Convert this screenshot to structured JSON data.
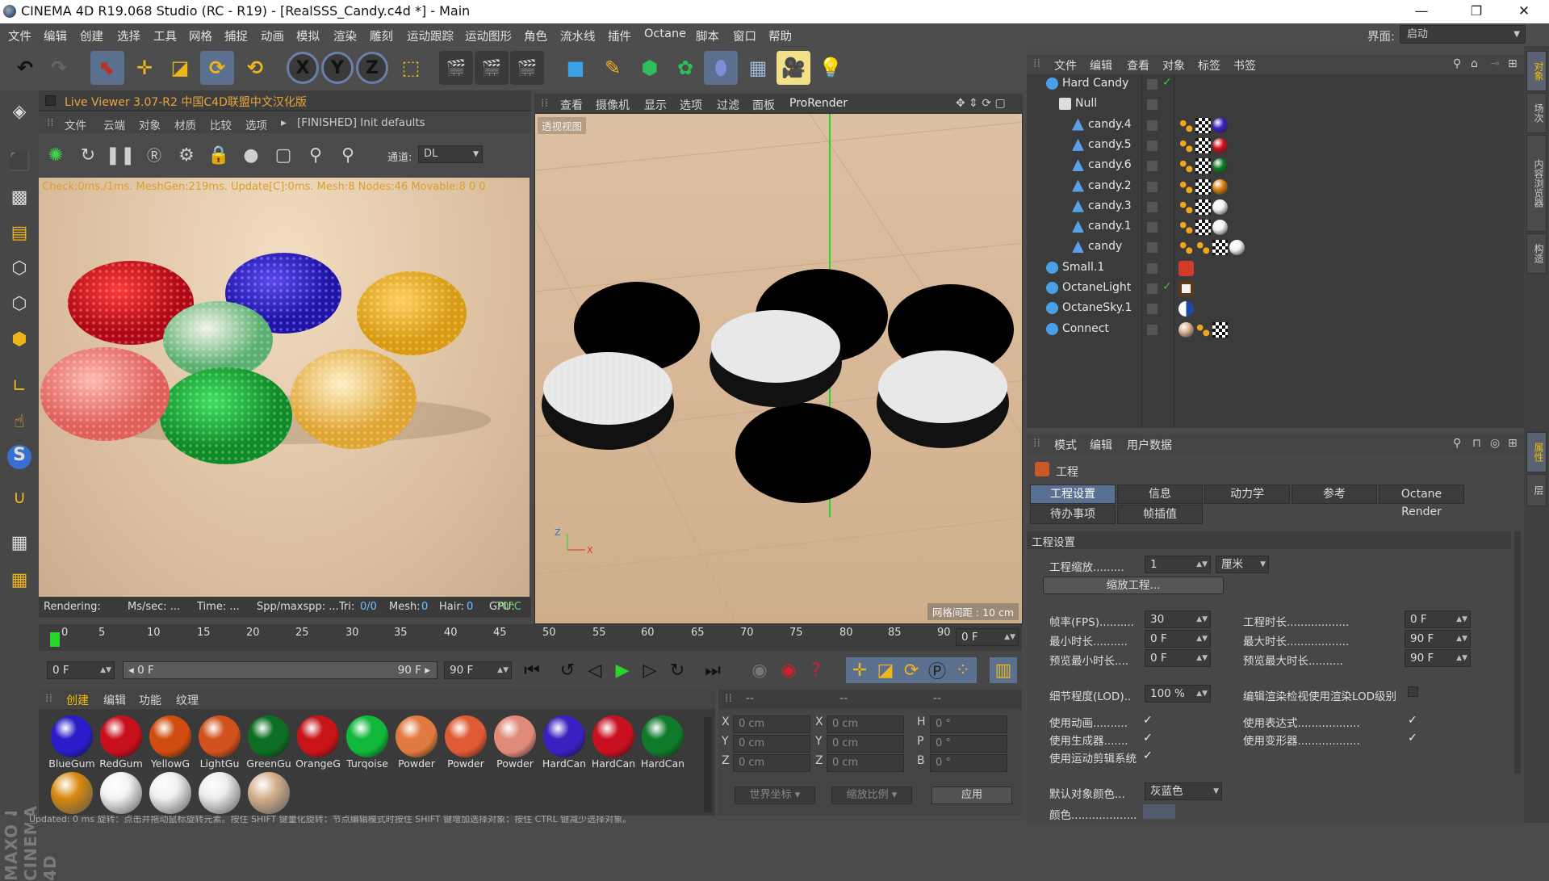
{
  "window": {
    "title": "CINEMA 4D R19.068 Studio (RC - R19) - [RealSSS_Candy.c4d *] - Main",
    "minimize": "—",
    "maximize": "❐",
    "close": "✕"
  },
  "menubar": {
    "items": [
      "文件",
      "编辑",
      "创建",
      "选择",
      "工具",
      "网格",
      "捕捉",
      "动画",
      "模拟",
      "渲染",
      "雕刻",
      "运动跟踪",
      "运动图形",
      "角色",
      "流水线",
      "插件",
      "Octane",
      "脚本",
      "窗口",
      "帮助"
    ],
    "layout_label": "界面:",
    "layout_value": "启动"
  },
  "toolbar": {
    "axis_x": "X",
    "axis_y": "Y",
    "axis_z": "Z"
  },
  "right_tabs": [
    "对象",
    "场次",
    "内容浏览器",
    "构造",
    "属性",
    "层"
  ],
  "live_viewer": {
    "title": "Live Viewer 3.07-R2 中国C4D联盟中文汉化版",
    "menu": [
      "文件",
      "云端",
      "对象",
      "材质",
      "比较",
      "选项",
      "▸",
      "[FINISHED] Init defaults"
    ],
    "channel_label": "通道:",
    "channel_value": "DL",
    "render_stats": "Check:0ms./1ms. MeshGen:219ms. Update[C]:0ms. Mesh:8 Nodes:46 Movable:8  0 0",
    "status": {
      "rendering": "Rendering:",
      "ms_sec": "Ms/sec: ...",
      "time": "Time: ...",
      "spp": "Spp/maxspp: ...",
      "tri_label": "Tri:",
      "tri_value": "0/0",
      "mesh_label": "Mesh:",
      "mesh_value": "0",
      "hair_label": "Hair:",
      "hair_value": "0",
      "gpu_label": "GPU:",
      "gpu_value": "70°C"
    }
  },
  "viewport": {
    "menu": [
      "查看",
      "摄像机",
      "显示",
      "选项",
      "过滤",
      "面板",
      "ProRender"
    ],
    "label": "透视视图",
    "grid_label": "网格间距 : 10 cm"
  },
  "timeline": {
    "ticks": [
      "0",
      "5",
      "10",
      "15",
      "20",
      "25",
      "30",
      "35",
      "40",
      "45",
      "50",
      "55",
      "60",
      "65",
      "70",
      "75",
      "80",
      "85",
      "90"
    ],
    "current_frame": "0 F",
    "start_field": "0 F",
    "range_start": "◂ 0 F",
    "range_end": "90 F ▸",
    "end_field": "90 F"
  },
  "material_manager": {
    "menu": [
      "创建",
      "编辑",
      "功能",
      "纹理"
    ],
    "materials": [
      {
        "name": "BlueGum",
        "color": "#2a1cc8"
      },
      {
        "name": "RedGum",
        "color": "#c8101c"
      },
      {
        "name": "YellowG",
        "color": "#d04c10"
      },
      {
        "name": "LightGu",
        "color": "#d2521e"
      },
      {
        "name": "GreenGu",
        "color": "#0c6e22"
      },
      {
        "name": "OrangeG",
        "color": "#c81418"
      },
      {
        "name": "Turqoise",
        "color": "#10b83a"
      },
      {
        "name": "Powder",
        "color": "#e07a40"
      },
      {
        "name": "Powder",
        "color": "#e05a34"
      },
      {
        "name": "Powder",
        "color": "#e08a7a"
      },
      {
        "name": "HardCan",
        "color": "#3a20c0"
      },
      {
        "name": "HardCan",
        "color": "#c81020"
      },
      {
        "name": "HardCan",
        "color": "#0e7a2a"
      }
    ],
    "second_row_colors": [
      "#d8880c",
      "#f4f4f4",
      "#f0f0f0",
      "#ececec",
      "#d4b08c"
    ]
  },
  "coord_manager": {
    "header": [
      "--",
      "--",
      "--"
    ],
    "rows": [
      {
        "a": "X",
        "v1": "0 cm",
        "b": "X",
        "v2": "0 cm",
        "c": "H",
        "v3": "0 °"
      },
      {
        "a": "Y",
        "v1": "0 cm",
        "b": "Y",
        "v2": "0 cm",
        "c": "P",
        "v3": "0 °"
      },
      {
        "a": "Z",
        "v1": "0 cm",
        "b": "Z",
        "v2": "0 cm",
        "c": "B",
        "v3": "0 °"
      }
    ],
    "world": "世界坐标",
    "scale": "缩放比例",
    "apply": "应用"
  },
  "statusbar": {
    "text": "Updated: 0 ms    旋转：点击并拖动鼠标旋转元素。按住 SHIFT 键量化旋转；节点编辑模式时按住 SHIFT 键增加选择对象；按住 CTRL 键减少选择对象。"
  },
  "object_manager": {
    "menu": [
      "文件",
      "编辑",
      "查看",
      "对象",
      "标签",
      "书签"
    ],
    "objects": [
      {
        "name": "Hard Candy",
        "indent": 0,
        "check": "✓",
        "tags": []
      },
      {
        "name": "Null",
        "indent": 1,
        "check": "",
        "tags": []
      },
      {
        "name": "candy.4",
        "indent": 2,
        "check": "",
        "tags": [
          "dots",
          "checker",
          "#3a1ec8"
        ]
      },
      {
        "name": "candy.5",
        "indent": 2,
        "check": "",
        "tags": [
          "dots",
          "checker",
          "#d0101c"
        ]
      },
      {
        "name": "candy.6",
        "indent": 2,
        "check": "",
        "tags": [
          "dots",
          "checker",
          "#0c7a24"
        ]
      },
      {
        "name": "candy.2",
        "indent": 2,
        "check": "",
        "tags": [
          "dots",
          "checker",
          "#d8800c"
        ]
      },
      {
        "name": "candy.3",
        "indent": 2,
        "check": "",
        "tags": [
          "dots",
          "checker",
          "#f2f2f2"
        ]
      },
      {
        "name": "candy.1",
        "indent": 2,
        "check": "",
        "tags": [
          "dots",
          "checker",
          "#f2f2f2"
        ]
      },
      {
        "name": "candy",
        "indent": 2,
        "check": "",
        "tags": [
          "dots",
          "dots",
          "checker",
          "#f2f2f2"
        ]
      },
      {
        "name": "Small.1",
        "indent": 0,
        "check": "",
        "tags": [
          "camera"
        ]
      },
      {
        "name": "OctaneLight",
        "indent": 0,
        "check": "✓",
        "tags": [
          "light"
        ]
      },
      {
        "name": "OctaneSky.1",
        "indent": 0,
        "check": "",
        "tags": [
          "sky"
        ]
      },
      {
        "name": "Connect",
        "indent": 0,
        "check": "",
        "tags": [
          "#d8b090",
          "dots",
          "checker"
        ]
      }
    ]
  },
  "attribute_manager": {
    "menu": [
      "模式",
      "编辑",
      "用户数据"
    ],
    "object_name": "工程",
    "tabs_row1": [
      "工程设置",
      "信息",
      "动力学",
      "参考",
      "Octane Render"
    ],
    "tabs_row2": [
      "待办事项",
      "帧插值"
    ],
    "section": "工程设置",
    "project_scale_label": "工程缩放.........",
    "project_scale_value": "1",
    "project_scale_unit": "厘米",
    "scale_project_button": "缩放工程...",
    "fields": [
      {
        "label": "帧率(FPS)..........",
        "value": "30",
        "label2": "工程时长..................",
        "value2": "0 F"
      },
      {
        "label": "最小时长..........",
        "value": "0 F",
        "label2": "最大时长..................",
        "value2": "90 F"
      },
      {
        "label": "预览最小时长....",
        "value": "0 F",
        "label2": "预览最大时长..........",
        "value2": "90 F"
      }
    ],
    "lod_label": "细节程度(LOD)..",
    "lod_value": "100 %",
    "render_lod_label": "编辑渲染检视使用渲染LOD级别",
    "checks": [
      {
        "label": "使用动画..........",
        "checked": "✓",
        "label2": "使用表达式..................",
        "checked2": "✓"
      },
      {
        "label": "使用生成器.......",
        "checked": "✓",
        "label2": "使用变形器..................",
        "checked2": "✓"
      },
      {
        "label": "使用运动剪辑系统",
        "checked": "✓",
        "label2": "",
        "checked2": ""
      }
    ],
    "default_color_label": "默认对象颜色...",
    "default_color_value": "灰蓝色",
    "color_label": "颜色..................."
  }
}
